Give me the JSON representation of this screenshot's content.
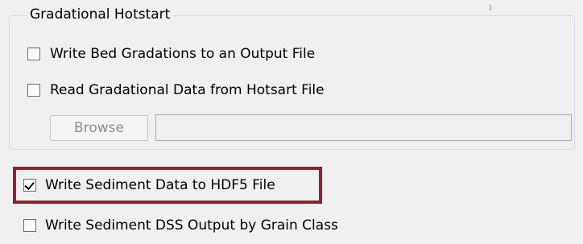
{
  "gradational_hotstart": {
    "title": "Gradational Hotstart",
    "write_bed_gradations": {
      "label": "Write Bed Gradations to an Output File",
      "checked": false
    },
    "read_gradational_data": {
      "label": "Read Gradational Data from Hotsart File",
      "checked": false
    },
    "browse_label": "Browse",
    "path_value": ""
  },
  "write_sediment_hdf5": {
    "label": "Write Sediment Data to HDF5 File",
    "checked": true
  },
  "write_sediment_dss": {
    "label": "Write Sediment DSS Output by Grain Class",
    "checked": false
  },
  "colors": {
    "highlight_border": "#9b1c2e",
    "background": "#f0f0f0",
    "disabled_text": "#8f8f8f"
  }
}
